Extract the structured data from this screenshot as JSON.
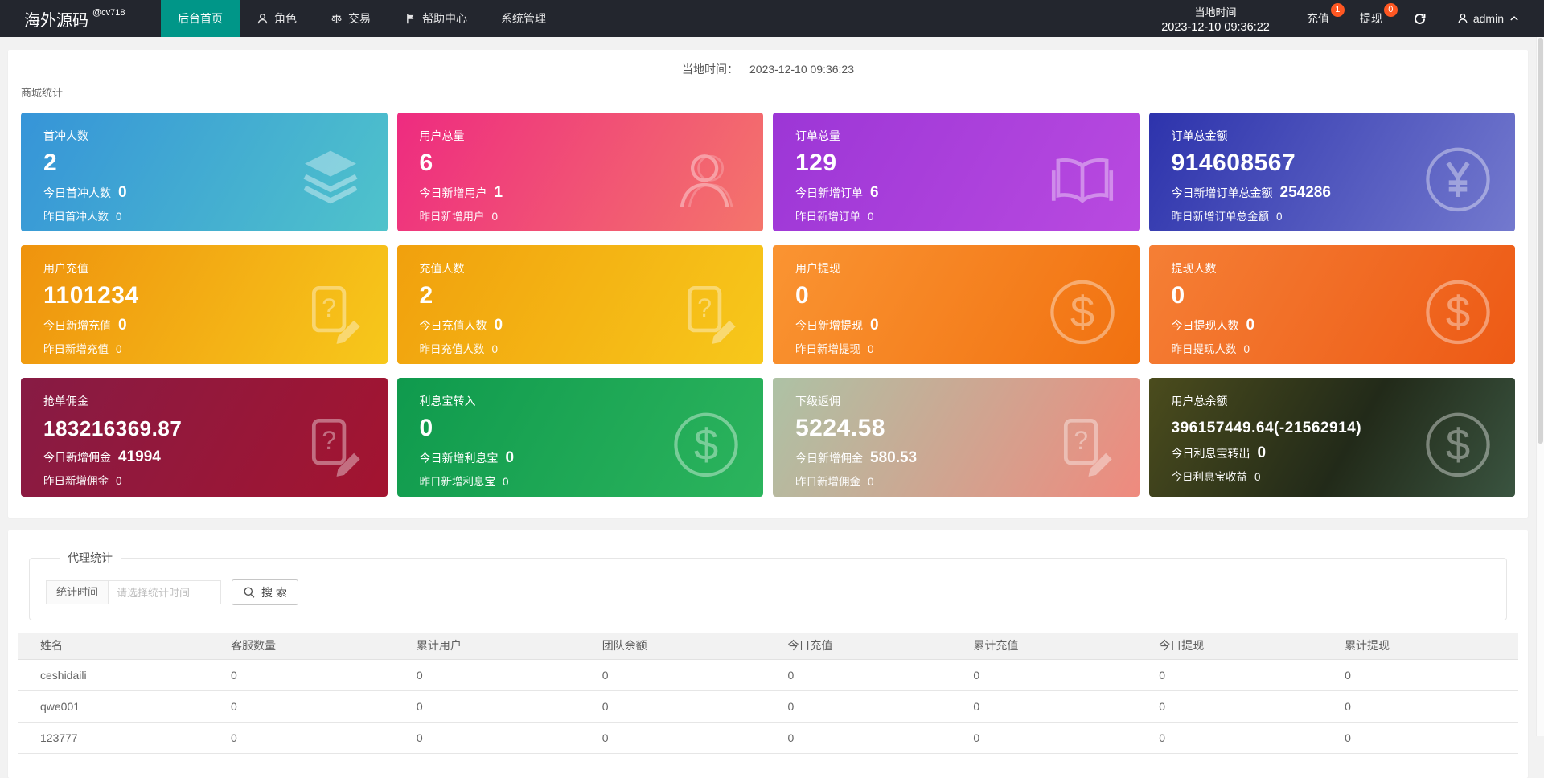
{
  "navbar": {
    "brand": "海外源码",
    "brand_super": "@cv718",
    "menu": [
      {
        "label": "后台首页",
        "icon": null,
        "active": true
      },
      {
        "label": "角色",
        "icon": "person",
        "active": false
      },
      {
        "label": "交易",
        "icon": "scales",
        "active": false
      },
      {
        "label": "帮助中心",
        "icon": "flag",
        "active": false
      },
      {
        "label": "系统管理",
        "icon": null,
        "active": false
      }
    ],
    "local_time_label": "当地时间",
    "local_time_value": "2023-12-10 09:36:22",
    "recharge_label": "充值",
    "recharge_badge": "1",
    "withdraw_label": "提现",
    "withdraw_badge": "0",
    "username": "admin",
    "accent_color": "#009688",
    "badge_color": "#FF5722"
  },
  "overview": {
    "local_time_label": "当地时间：",
    "local_time_value": "2023-12-10 09:36:23",
    "section_title": "商城统计",
    "cards": [
      {
        "title": "首冲人数",
        "value": "2",
        "line1_label": "今日首冲人数",
        "line1_value": "0",
        "line2_label": "昨日首冲人数",
        "line2_value": "0",
        "icon": "layers",
        "bg": "linear-gradient(120deg,#3694d8,#4fc3cb)"
      },
      {
        "title": "用户总量",
        "value": "6",
        "line1_label": "今日新增用户",
        "line1_value": "1",
        "line2_label": "昨日新增用户",
        "line2_value": "0",
        "icon": "user",
        "bg": "linear-gradient(120deg,#ee2b80,#f4756b)"
      },
      {
        "title": "订单总量",
        "value": "129",
        "line1_label": "今日新增订单",
        "line1_value": "6",
        "line2_label": "昨日新增订单",
        "line2_value": "0",
        "icon": "book",
        "bg": "linear-gradient(120deg,#9c36d6,#b94ae0)"
      },
      {
        "title": "订单总金额",
        "value": "914608567",
        "line1_label": "今日新增订单总金额",
        "line1_value": "254286",
        "line2_label": "昨日新增订单总金额",
        "line2_value": "0",
        "icon": "yen",
        "bg": "linear-gradient(120deg,#2d33ac,#7379ce)"
      },
      {
        "title": "用户充值",
        "value": "1101234",
        "line1_label": "今日新增充值",
        "line1_value": "0",
        "line2_label": "昨日新增充值",
        "line2_value": "0",
        "icon": "doc",
        "bg": "linear-gradient(120deg,#ef930e,#f7c81b)"
      },
      {
        "title": "充值人数",
        "value": "2",
        "line1_label": "今日充值人数",
        "line1_value": "0",
        "line2_label": "昨日充值人数",
        "line2_value": "0",
        "icon": "doc",
        "bg": "linear-gradient(120deg,#f1a00d,#f7c81b)"
      },
      {
        "title": "用户提现",
        "value": "0",
        "line1_label": "今日新增提现",
        "line1_value": "0",
        "line2_label": "昨日新增提现",
        "line2_value": "0",
        "icon": "dollar",
        "bg": "linear-gradient(120deg,#fa9432,#f17110)"
      },
      {
        "title": "提现人数",
        "value": "0",
        "line1_label": "今日提现人数",
        "line1_value": "0",
        "line2_label": "昨日提现人数",
        "line2_value": "0",
        "icon": "dollar",
        "bg": "linear-gradient(120deg,#f57f35,#ed5a15)"
      },
      {
        "title": "抢单佣金",
        "value": "183216369.87",
        "line1_label": "今日新增佣金",
        "line1_value": "41994",
        "line2_label": "昨日新增佣金",
        "line2_value": "0",
        "icon": "doc",
        "bg": "linear-gradient(120deg,#871b44,#a31430)"
      },
      {
        "title": "利息宝转入",
        "value": "0",
        "line1_label": "今日新增利息宝",
        "line1_value": "0",
        "line2_label": "昨日新增利息宝",
        "line2_value": "0",
        "icon": "dollar",
        "bg": "linear-gradient(120deg,#0f9a4d,#2cb45d)"
      },
      {
        "title": "下级返佣",
        "value": "5224.58",
        "line1_label": "今日新增佣金",
        "line1_value": "580.53",
        "line2_label": "昨日新增佣金",
        "line2_value": "0",
        "icon": "doc",
        "bg": "linear-gradient(120deg,#adc2a5,#ef8a7e)"
      },
      {
        "title": "用户总余额",
        "value": "396157449.64(-21562914)",
        "line1_label": "今日利息宝转出",
        "line1_value": "0",
        "line2_label": "今日利息宝收益",
        "line2_value": "0",
        "icon": "dollar",
        "bg": "linear-gradient(120deg,#4b4c1d,#222a19 55%,#3a5440)"
      }
    ]
  },
  "agent": {
    "legend": "代理统计",
    "filter_label": "统计时间",
    "filter_placeholder": "请选择统计时间",
    "search_label": "搜 索",
    "table": {
      "headers": [
        "姓名",
        "客服数量",
        "累计用户",
        "团队余额",
        "今日充值",
        "累计充值",
        "今日提现",
        "累计提现"
      ],
      "rows": [
        [
          "ceshidaili",
          "0",
          "0",
          "0",
          "0",
          "0",
          "0",
          "0"
        ],
        [
          "qwe001",
          "0",
          "0",
          "0",
          "0",
          "0",
          "0",
          "0"
        ],
        [
          "123777",
          "0",
          "0",
          "0",
          "0",
          "0",
          "0",
          "0"
        ]
      ]
    }
  }
}
